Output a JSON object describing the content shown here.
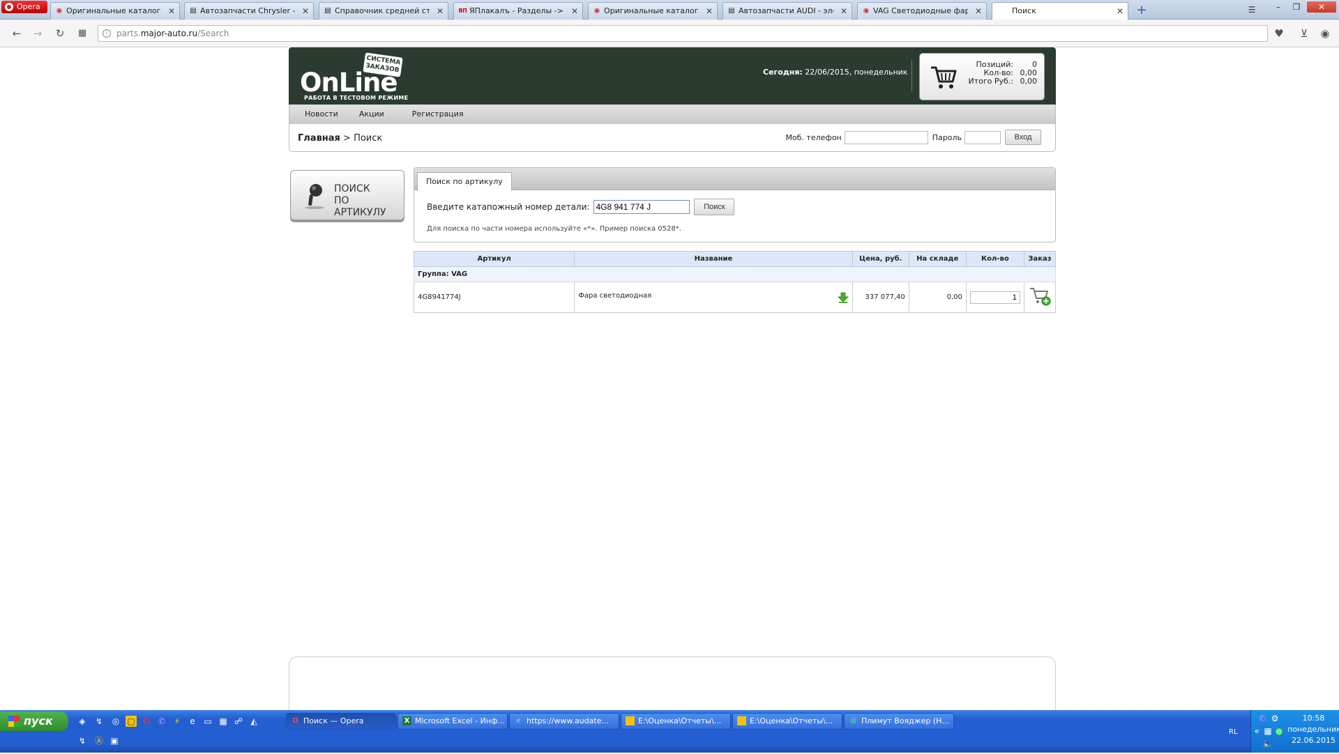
{
  "browser": {
    "menu_label": "Opera",
    "tabs": [
      {
        "label": "Оригинальные каталоги | а",
        "icon": "globe-icon"
      },
      {
        "label": "Автозапчасти Chrysler - эле",
        "icon": "page-icon"
      },
      {
        "label": "Справочник средней стоим",
        "icon": "page-icon"
      },
      {
        "label": "ЯПлакалъ - Разделы -> Цит",
        "icon": "yap-icon"
      },
      {
        "label": "Оригинальные каталоги | а",
        "icon": "globe-icon"
      },
      {
        "label": "Автозапчасти AUDI - элект",
        "icon": "page-icon"
      },
      {
        "label": "VAG Светодиодные фары",
        "icon": "globe-icon"
      },
      {
        "label": "Поиск",
        "icon": ""
      }
    ],
    "url_prefix": "parts.",
    "url_host": "major-auto.ru",
    "url_path": "/Search"
  },
  "site": {
    "logo_text": "OnLine",
    "logo_badge_line1": "СИСТЕМА",
    "logo_badge_line2": "ЗАКАЗОВ",
    "logo_sub": "РАБОТА В ТЕСТОВОМ РЕЖИМЕ",
    "today_label": "Сегодня:",
    "today_value": "22/06/2015, понедельник",
    "cart": {
      "positions_label": "Позиций:",
      "positions_value": "0",
      "qty_label": "Кол-во:",
      "qty_value": "0,00",
      "total_label": "Итого Руб.:",
      "total_value": "0,00"
    },
    "menu": [
      "Новости",
      "Акции",
      "Регистрация"
    ],
    "breadcrumb_home": "Главная",
    "breadcrumb_sep": " > ",
    "breadcrumb_current": "Поиск",
    "login": {
      "phone_label": "Моб. телефон",
      "password_label": "Пароль",
      "submit_label": "Вход"
    },
    "side_button_line1": "ПОИСК",
    "side_button_line2": "ПО АРТИКУЛУ",
    "search": {
      "tab_label": "Поиск по артикулу",
      "prompt": "Введите катапожный номер детали:",
      "value": "4G8 941 774 J",
      "button": "Поиск",
      "hint": "Для поиска по части номера используйте «*». Пример поиска 0528*."
    },
    "table": {
      "headers": [
        "Артикул",
        "Название",
        "Цена, руб.",
        "На складе",
        "Кол-во",
        "Заказ"
      ],
      "group": "Группа: VAG",
      "rows": [
        {
          "article": "4G8941774J",
          "name": "Фара светодиодная",
          "price": "337 077,40",
          "stock": "0,00",
          "qty": "1"
        }
      ]
    }
  },
  "taskbar": {
    "start_label": "пуск",
    "buttons": [
      {
        "label": "Поиск — Opera",
        "icon": "opera-icon"
      },
      {
        "label": "Microsoft Excel - Инф...",
        "icon": "excel-icon"
      },
      {
        "label": "https://www.audate...",
        "icon": "ie-icon"
      },
      {
        "label": "E:\\Оценка\\Отчеты\\...",
        "icon": "folder-icon"
      },
      {
        "label": "E:\\Оценка\\Отчеты\\...",
        "icon": "folder-icon"
      },
      {
        "label": "Плимут Вояджер (Н...",
        "icon": "chrome-icon"
      }
    ],
    "lang": "RL",
    "time": "10:58",
    "weekday": "понедельник",
    "date": "22.06.2015"
  },
  "colors": {
    "header_bg": "#2c3b30",
    "table_header_bg": "#dce8f7",
    "taskbar_blue": "#245fd1",
    "start_green": "#3a9d36"
  }
}
